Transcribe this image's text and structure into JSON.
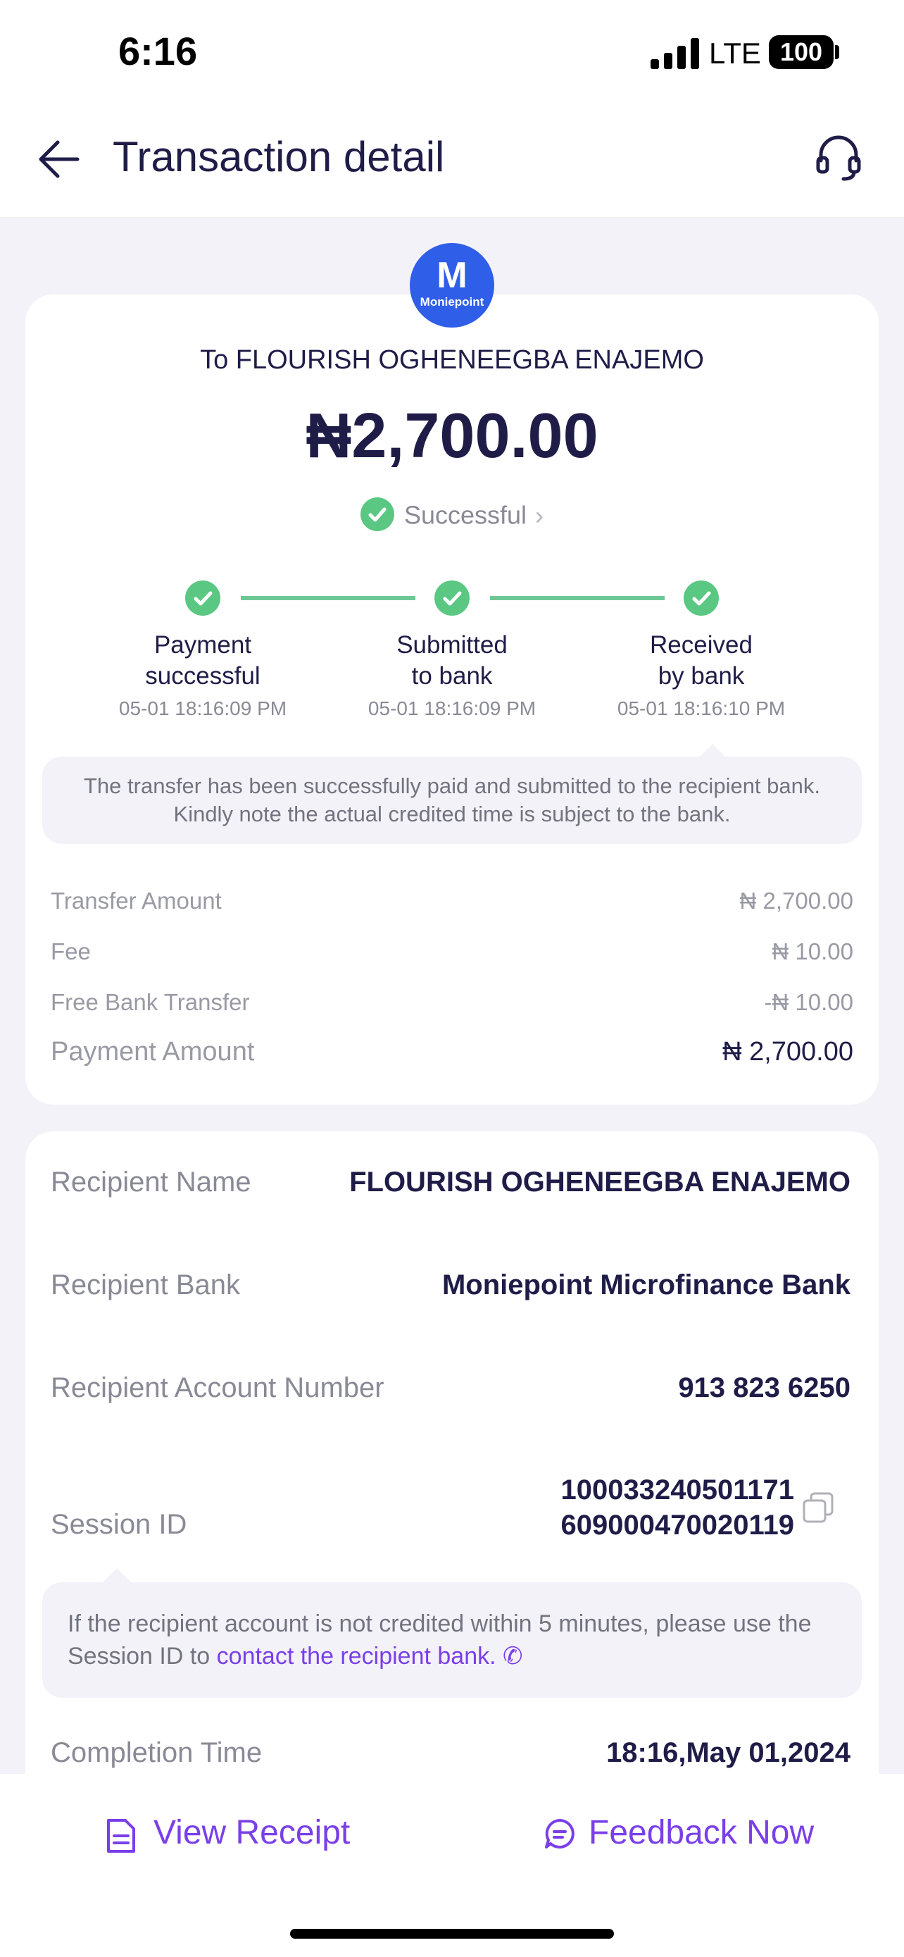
{
  "status_bar": {
    "time": "6:16",
    "network": "LTE",
    "battery": "100"
  },
  "header": {
    "title": "Transaction detail"
  },
  "logo": {
    "letter": "M",
    "wordmark": "Moniepoint",
    "color": "#2f5ee8"
  },
  "summary": {
    "to_line": "To FLOURISH OGHENEEGBA ENAJEMO",
    "amount": "₦2,700.00",
    "status": "Successful",
    "accent": "#5ac882"
  },
  "timeline": [
    {
      "label_1": "Payment",
      "label_2": "successful",
      "time": "05-01 18:16:09 PM"
    },
    {
      "label_1": "Submitted",
      "label_2": "to bank",
      "time": "05-01 18:16:09 PM"
    },
    {
      "label_1": "Received",
      "label_2": "by bank",
      "time": "05-01 18:16:10 PM"
    }
  ],
  "transfer_note": {
    "line_1": "The transfer has been successfully paid and submitted to the recipient bank.",
    "line_2": "Kindly note the actual credited time is subject to the bank."
  },
  "fees": [
    {
      "label": "Transfer Amount",
      "value": "₦ 2,700.00"
    },
    {
      "label": "Fee",
      "value": "₦ 10.00"
    },
    {
      "label": "Free Bank Transfer",
      "value": "-₦ 10.00"
    },
    {
      "label": "Payment Amount",
      "value": "₦ 2,700.00"
    }
  ],
  "details": {
    "recipient_name_label": "Recipient Name",
    "recipient_name": "FLOURISH OGHENEEGBA ENAJEMO",
    "recipient_bank_label": "Recipient Bank",
    "recipient_bank": "Moniepoint Microfinance Bank",
    "account_number_label": "Recipient Account Number",
    "account_number": "913 823 6250",
    "session_id_label": "Session ID",
    "session_id_line_1": "100033240501171",
    "session_id_line_2": "609000470020119",
    "completion_time_label": "Completion Time",
    "completion_time": "18:16,May 01,2024"
  },
  "session_note": {
    "line_1": "If the recipient account is not credited within 5 minutes, please use the",
    "line_2_prefix": "Session ID to ",
    "link": "contact the recipient bank."
  },
  "actions": {
    "view_receipt": "View Receipt",
    "feedback": "Feedback Now",
    "accent": "#7a3fe8"
  }
}
